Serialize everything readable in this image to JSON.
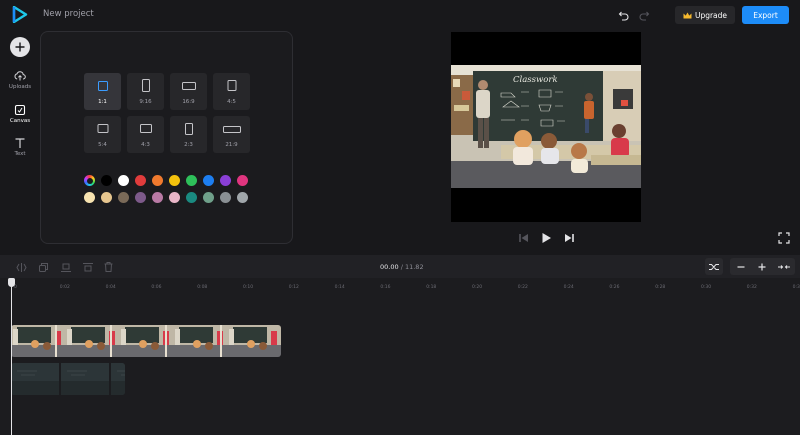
{
  "app": {
    "project_title": "New project"
  },
  "toolbar": {
    "upgrade_label": "Upgrade",
    "export_label": "Export",
    "upgrade_icon": "crown-icon"
  },
  "rail": {
    "items": [
      {
        "label": "Uploads",
        "icon": "upload-cloud-icon"
      },
      {
        "label": "Canvas",
        "icon": "canvas-icon"
      },
      {
        "label": "Text",
        "icon": "text-icon"
      }
    ],
    "active": "Canvas"
  },
  "canvas_panel": {
    "ratios": [
      {
        "label": "1:1",
        "active": true
      },
      {
        "label": "9:16"
      },
      {
        "label": "16:9"
      },
      {
        "label": "4:5"
      },
      {
        "label": "5:4"
      },
      {
        "label": "4:3"
      },
      {
        "label": "2:3"
      },
      {
        "label": "21:9"
      }
    ],
    "colors_row1": [
      "#000000",
      "#ffffff",
      "#e03c3c",
      "#f07a2e",
      "#f4c20d",
      "#2ec05a",
      "#1d7ef0",
      "#8a3fd6",
      "#e0357f"
    ],
    "colors_row2": [
      "#f7e3b0",
      "#e6c68f",
      "#7a6a58",
      "#7d5a8a",
      "#b97aa5",
      "#e9b6c8",
      "#1a8a80",
      "#6fa08a",
      "#8a9094",
      "#a0a6aa"
    ]
  },
  "preview": {
    "chalkboard_text": "Classwork"
  },
  "timeline": {
    "current_time": "00.00",
    "separator": "/",
    "total_time": "11.82",
    "ticks": [
      "0",
      "0:02",
      "0:04",
      "0:06",
      "0:08",
      "0:10",
      "0:12",
      "0:14",
      "0:16",
      "0:18",
      "0:20",
      "0:22",
      "0:24",
      "0:26",
      "0:28",
      "0:30",
      "0:32",
      "0:34"
    ]
  }
}
